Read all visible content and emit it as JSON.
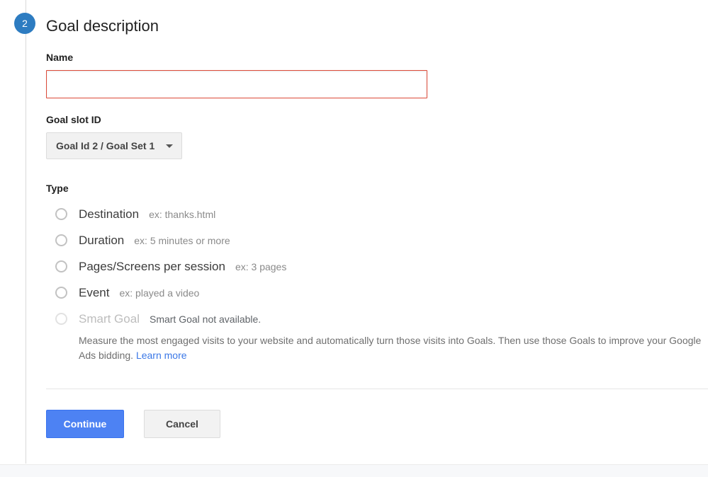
{
  "step": {
    "number": "2",
    "title": "Goal description"
  },
  "name_field": {
    "label": "Name",
    "value": "",
    "placeholder": ""
  },
  "goal_slot": {
    "label": "Goal slot ID",
    "selected": "Goal Id 2 / Goal Set 1",
    "options": [
      "Goal Id 2 / Goal Set 1"
    ]
  },
  "type": {
    "label": "Type",
    "options": [
      {
        "name": "Destination",
        "hint": "ex: thanks.html",
        "disabled": false,
        "selected": false
      },
      {
        "name": "Duration",
        "hint": "ex: 5 minutes or more",
        "disabled": false,
        "selected": false
      },
      {
        "name": "Pages/Screens per session",
        "hint": "ex: 3 pages",
        "disabled": false,
        "selected": false
      },
      {
        "name": "Event",
        "hint": "ex: played a video",
        "disabled": false,
        "selected": false
      },
      {
        "name": "Smart Goal",
        "hint": "Smart Goal not available.",
        "disabled": true,
        "selected": false
      }
    ],
    "smart_goal_description": "Measure the most engaged visits to your website and automatically turn those visits into Goals. Then use those Goals to improve your Google Ads bidding.",
    "smart_goal_link": "Learn more"
  },
  "actions": {
    "continue_label": "Continue",
    "cancel_label": "Cancel"
  },
  "colors": {
    "step_badge": "#2d7cc1",
    "primary_button": "#4d82f3",
    "error_border": "#dd4b39",
    "link": "#3b78e7"
  }
}
